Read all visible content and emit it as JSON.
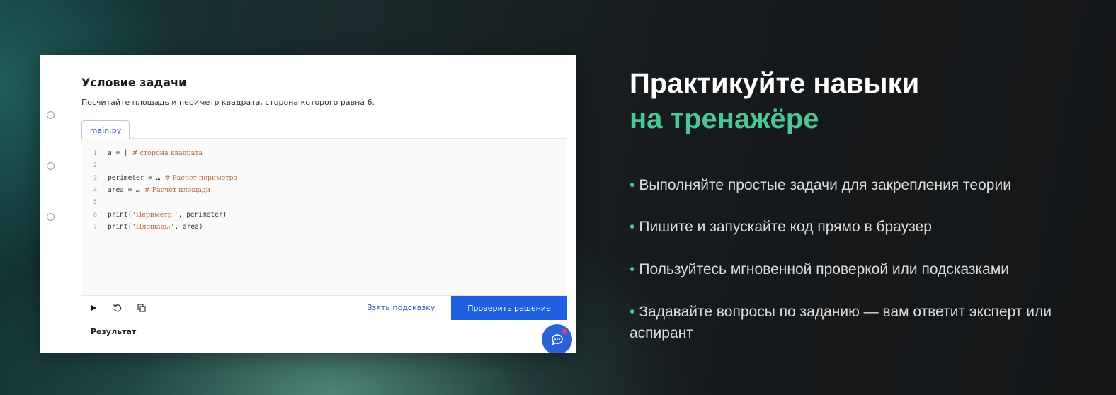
{
  "screenshot": {
    "task_title": "Условие задачи",
    "task_description": "Посчитайте площадь и периметр квадрата, сторона которого равна 6.",
    "tab_label": "main.py",
    "code_lines": [
      {
        "num": "1",
        "code": "a = |",
        "comment": "# сторона квадрата"
      },
      {
        "num": "2",
        "code": "",
        "comment": ""
      },
      {
        "num": "3",
        "code": "perimeter = …",
        "comment": "# Расчет периметра"
      },
      {
        "num": "4",
        "code": "area = …",
        "comment": "# Расчет площади"
      },
      {
        "num": "5",
        "code": "",
        "comment": ""
      },
      {
        "num": "6",
        "code_pre": "print('",
        "code_str": "Периметр:",
        "code_post": "', perimeter)"
      },
      {
        "num": "7",
        "code_pre": "print('",
        "code_str": "Площадь:",
        "code_post": "', area)"
      }
    ],
    "toolbar": {
      "run_icon": "play-icon",
      "reset_icon": "reset-icon",
      "copy_icon": "copy-icon",
      "hint_label": "Взять подсказку",
      "check_label": "Проверить решение"
    },
    "result_label": "Результат",
    "chat_icon": "chat-icon"
  },
  "promo": {
    "heading_line1": "Практикуйте навыки",
    "heading_line2": "на тренажёре",
    "bullet_char": "•",
    "features": [
      "Выполняйте простые задачи для закрепления теории",
      "Пишите и запускайте код прямо в браузер",
      "Пользуйтесь мгновенной проверкой или подсказками",
      "Задавайте вопросы по заданию — вам ответит эксперт или аспирант"
    ]
  },
  "colors": {
    "accent_green": "#4cc694",
    "button_blue": "#1f5fe0",
    "link_blue": "#3b5bb6"
  }
}
